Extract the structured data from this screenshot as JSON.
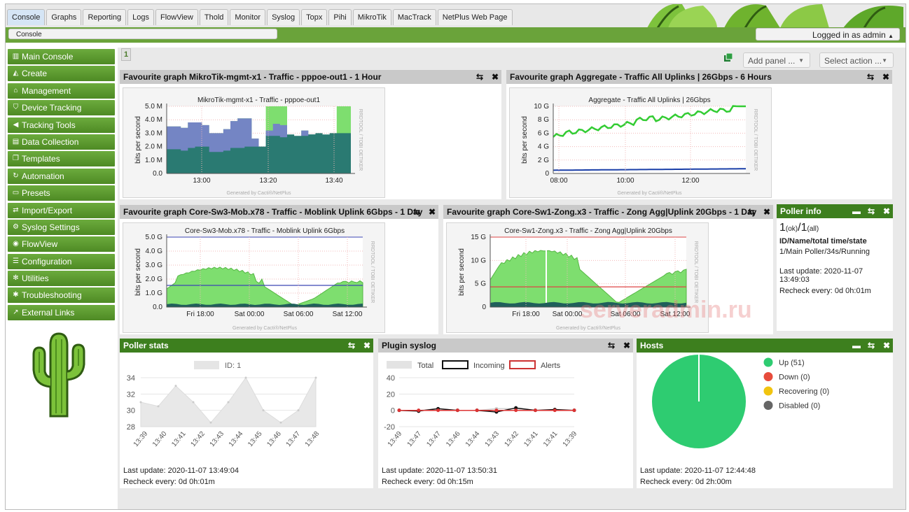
{
  "tabs": [
    "Console",
    "Graphs",
    "Reporting",
    "Logs",
    "FlowView",
    "Thold",
    "Monitor",
    "Syslog",
    "Topx",
    "Pihi",
    "MikroTik",
    "MacTrack",
    "NetPlus Web Page"
  ],
  "breadcrumb": "Console",
  "login_text": "Logged in as admin",
  "sidebar": [
    {
      "label": "Main Console",
      "icon": "chart-icon"
    },
    {
      "label": "Create",
      "icon": "area-chart-icon"
    },
    {
      "label": "Management",
      "icon": "home-icon"
    },
    {
      "label": "Device Tracking",
      "icon": "shield-icon"
    },
    {
      "label": "Tracking Tools",
      "icon": "megaphone-icon"
    },
    {
      "label": "Data Collection",
      "icon": "database-icon"
    },
    {
      "label": "Templates",
      "icon": "copy-icon"
    },
    {
      "label": "Automation",
      "icon": "refresh-icon"
    },
    {
      "label": "Presets",
      "icon": "window-icon"
    },
    {
      "label": "Import/Export",
      "icon": "exchange-icon"
    },
    {
      "label": "Syslog Settings",
      "icon": "gear-icon"
    },
    {
      "label": "FlowView",
      "icon": "flow-icon"
    },
    {
      "label": "Configuration",
      "icon": "sliders-icon"
    },
    {
      "label": "Utilities",
      "icon": "cogs-icon"
    },
    {
      "label": "Troubleshooting",
      "icon": "bug-icon"
    },
    {
      "label": "External Links",
      "icon": "external-link-icon"
    }
  ],
  "page_number": "1",
  "toolbar": {
    "add_panel": "Add panel ...",
    "select_action": "Select action ..."
  },
  "panels": {
    "p1": {
      "title": "Favourite graph MikroTik-mgmt-x1 - Traffic - pppoe-out1 - 1 Hour",
      "graph_title": "MikroTik-mgmt-x1 - Traffic - pppoe-out1",
      "ylabel": "bits per second",
      "yticks": [
        "5.0 M",
        "4.0 M",
        "3.0 M",
        "2.0 M",
        "1.0 M",
        "0.0"
      ],
      "xticks": [
        "13:00",
        "13:20",
        "13:40"
      ],
      "side": "RRDTOOL / TOBI OETIKER",
      "footer": "Generated by Cacti®/NetPlus"
    },
    "p2": {
      "title": "Favourite graph Aggregate - Traffic All Uplinks | 26Gbps - 6 Hours",
      "graph_title": "Aggregate - Traffic All Uplinks | 26Gbps",
      "ylabel": "bits per second",
      "yticks": [
        "10 G",
        "8 G",
        "6 G",
        "4 G",
        "2 G",
        "0"
      ],
      "xticks": [
        "08:00",
        "10:00",
        "12:00"
      ],
      "side": "RRDTOOL / TOBI OETIKER",
      "footer": "Generated by Cacti®/NetPlus"
    },
    "p3": {
      "title": "Favourite graph Core-Sw3-Mob.x78 - Traffic - Moblink Uplink 6Gbps - 1 Day",
      "graph_title": "Core-Sw3-Mob.x78 - Traffic - Moblink Uplink 6Gbps",
      "ylabel": "bits per second",
      "yticks": [
        "5.0 G",
        "4.0 G",
        "3.0 G",
        "2.0 G",
        "1.0 G",
        "0.0"
      ],
      "xticks": [
        "Fri 18:00",
        "Sat 00:00",
        "Sat 06:00",
        "Sat 12:00"
      ],
      "side": "RRDTOOL / TOBI OETIKER",
      "footer": "Generated by Cacti®/NetPlus"
    },
    "p4": {
      "title": "Favourite graph Core-Sw1-Zong.x3 - Traffic - Zong Agg|Uplink 20Gbps - 1 Day",
      "graph_title": "Core-Sw1-Zong.x3 - Traffic - Zong Agg|Uplink 20Gbps",
      "ylabel": "bits per second",
      "yticks": [
        "15 G",
        "10 G",
        "5 G",
        "0"
      ],
      "xticks": [
        "Fri 18:00",
        "Sat 00:00",
        "Sat 06:00",
        "Sat 12:00"
      ],
      "side": "RRDTOOL / TOBI OETIKER",
      "footer": "Generated by Cacti®/NetPlus"
    },
    "poller_info": {
      "title": "Poller info",
      "counts_ok": "1",
      "counts_ok_sub": "(ok)",
      "slash": "/",
      "counts_all": "1",
      "counts_all_sub": "(all)",
      "heading": "ID/Name/total time/state",
      "row": "1/Main Poller/34s/Running",
      "last_update": "Last update: 2020-11-07 13:49:03",
      "recheck": "Recheck every: 0d 0h:01m"
    },
    "poller_stats": {
      "title": "Poller stats",
      "legend": "ID: 1",
      "last_update": "Last update: 2020-11-07 13:49:04",
      "recheck": "Recheck every: 0d 0h:01m"
    },
    "plugin_syslog": {
      "title": "Plugin syslog",
      "legend": [
        "Total",
        "Incoming",
        "Alerts"
      ],
      "last_update": "Last update: 2020-11-07 13:50:31",
      "recheck": "Recheck every: 0d 0h:15m"
    },
    "hosts": {
      "title": "Hosts",
      "legend": [
        "Up (51)",
        "Down (0)",
        "Recovering (0)",
        "Disabled (0)"
      ],
      "last_update": "Last update: 2020-11-07 12:44:48",
      "recheck": "Recheck every: 0d 2h:00m"
    }
  },
  "watermark": "serveradmin.ru",
  "colors": {
    "accent_green": "#3d7f1e",
    "traffic_green": "#6fd26b",
    "traffic_blue": "#6677bb",
    "up": "#2ecc71",
    "down": "#e74c3c",
    "recovering": "#f1c40f",
    "disabled": "#666666"
  },
  "chart_data": [
    {
      "type": "line",
      "title": "",
      "categories": [
        "13:49",
        "13:48",
        "13:47",
        "13:46",
        "13:45",
        "13:44",
        "13:43",
        "13:42",
        "13:41",
        "13:40",
        "13:39"
      ],
      "xtick_labels": [
        "13:39",
        "13:40",
        "13:41",
        "13:42",
        "13:43",
        "13:44",
        "13:45",
        "13:46",
        "13:47",
        "13:48"
      ],
      "series": [
        {
          "name": "ID: 1",
          "values": [
            31,
            30.5,
            33,
            31,
            28.5,
            31,
            34,
            30,
            28.5,
            30,
            34
          ]
        }
      ],
      "ylim": [
        28,
        34
      ],
      "yticks": [
        28,
        30,
        32,
        34
      ]
    },
    {
      "type": "line",
      "title": "",
      "xtick_labels": [
        "13:49",
        "13:47",
        "13:47",
        "13:46",
        "13:44",
        "13:43",
        "13:42",
        "13:41",
        "13:41",
        "13:39"
      ],
      "series": [
        {
          "name": "Total",
          "values": [
            0,
            0,
            2,
            0,
            0,
            2,
            2,
            0,
            0,
            0
          ]
        },
        {
          "name": "Incoming",
          "values": [
            0,
            -1,
            2,
            0,
            0,
            -2,
            3,
            0,
            1,
            0
          ]
        },
        {
          "name": "Alerts",
          "values": [
            0,
            0,
            0,
            0,
            0,
            0,
            0,
            0,
            0,
            0
          ]
        }
      ],
      "ylim": [
        -20,
        40
      ],
      "yticks": [
        -20,
        0,
        20,
        40
      ]
    },
    {
      "type": "pie",
      "title": "",
      "categories": [
        "Up (51)",
        "Down (0)",
        "Recovering (0)",
        "Disabled (0)"
      ],
      "values": [
        51,
        0,
        0,
        0
      ]
    }
  ]
}
